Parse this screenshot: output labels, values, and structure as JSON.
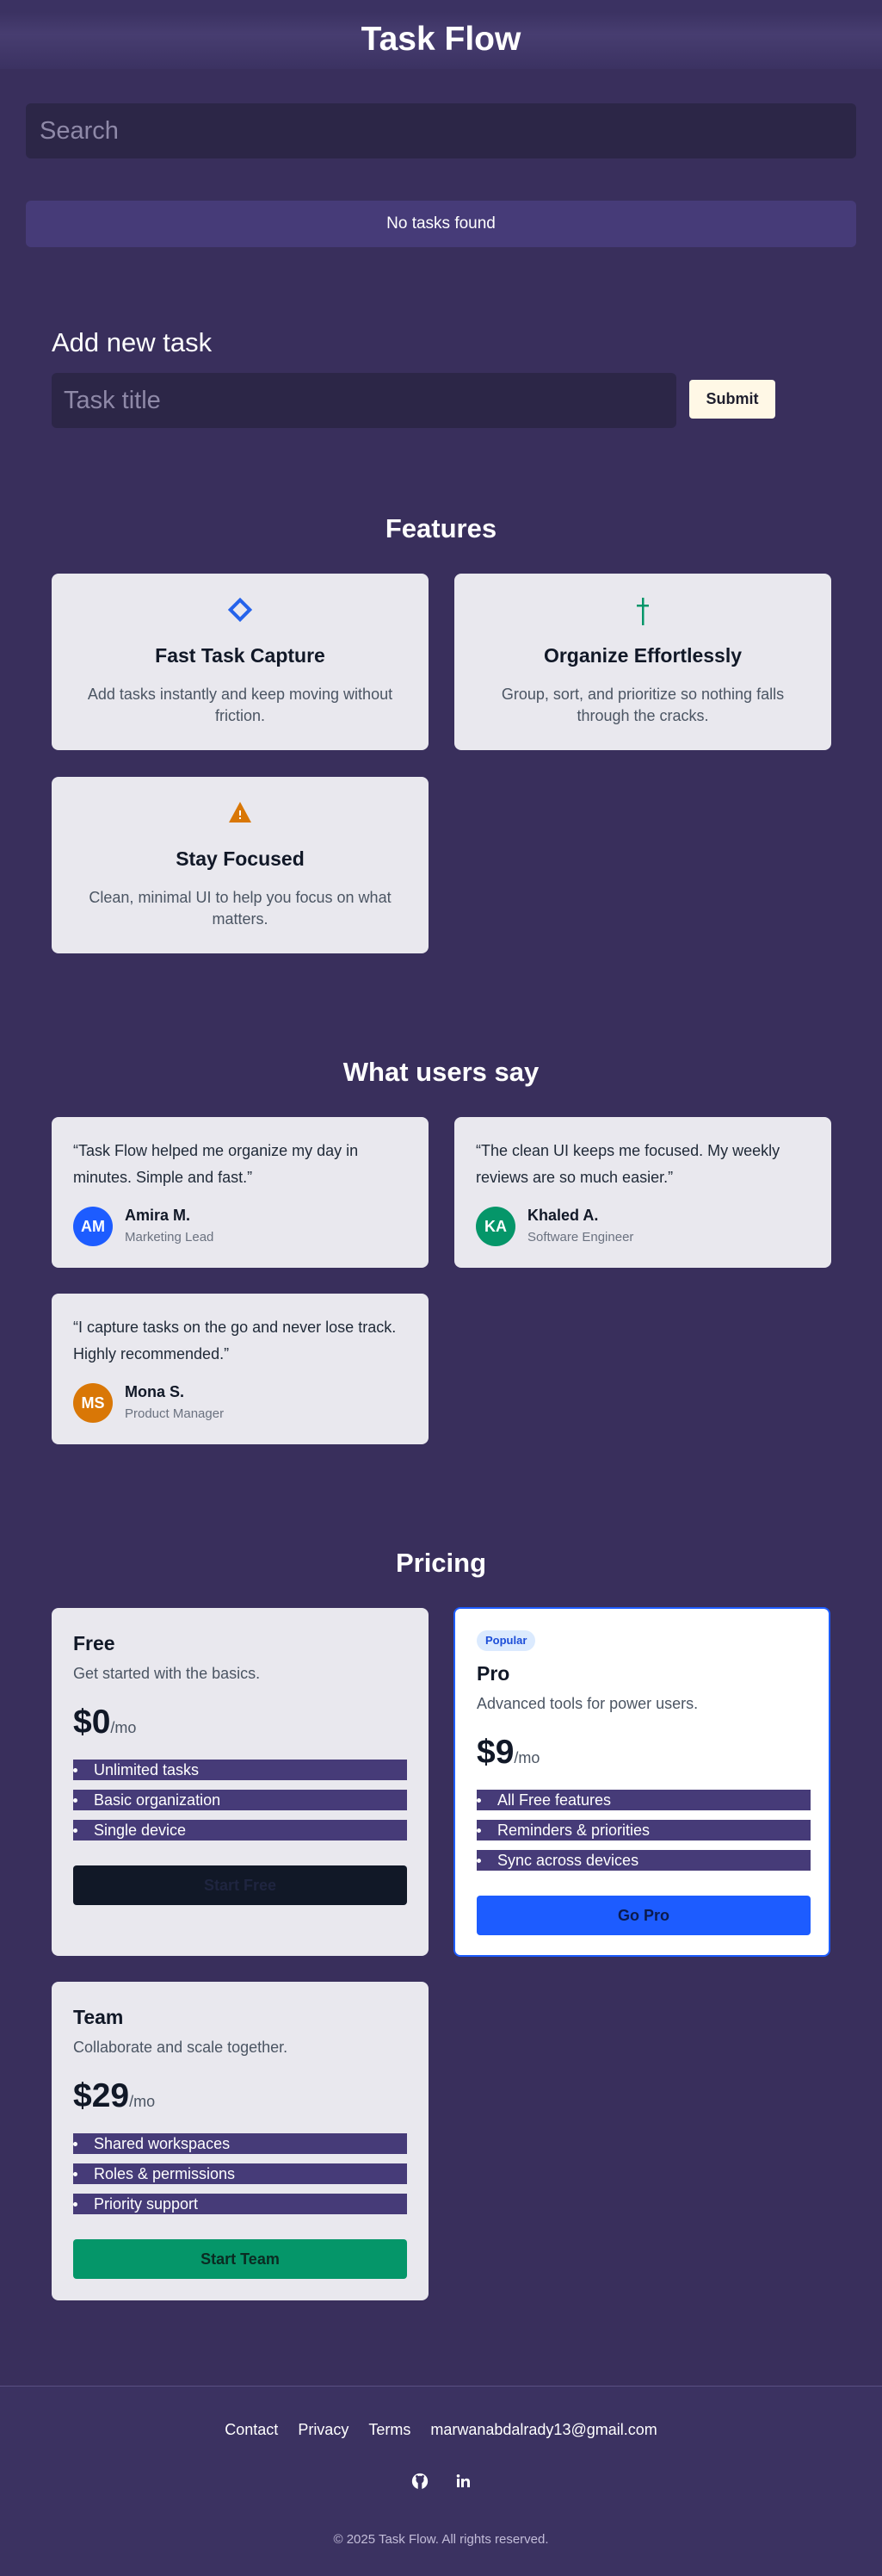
{
  "app": {
    "title": "Task Flow"
  },
  "search": {
    "placeholder": "Search"
  },
  "tasks": {
    "empty_message": "No tasks found"
  },
  "add_task": {
    "heading": "Add new task",
    "placeholder": "Task title",
    "submit_label": "Submit"
  },
  "features": {
    "heading": "Features",
    "items": [
      {
        "icon": "diamond-icon",
        "title": "Fast Task Capture",
        "description": "Add tasks instantly and keep moving without friction.",
        "color": "#2563eb"
      },
      {
        "icon": "dagger-icon",
        "title": "Organize Effortlessly",
        "description": "Group, sort, and prioritize so nothing falls through the cracks.",
        "color": "#059669"
      },
      {
        "icon": "warning-triangle-icon",
        "title": "Stay Focused",
        "description": "Clean, minimal UI to help you focus on what matters.",
        "color": "#d97706"
      }
    ]
  },
  "testimonials": {
    "heading": "What users say",
    "items": [
      {
        "quote": "“Task Flow helped me organize my day in minutes. Simple and fast.”",
        "initials": "AM",
        "name": "Amira M.",
        "role": "Marketing Lead",
        "color": "#2563eb"
      },
      {
        "quote": "“The clean UI keeps me focused. My weekly reviews are so much easier.”",
        "initials": "KA",
        "name": "Khaled A.",
        "role": "Software Engineer",
        "color": "#059669"
      },
      {
        "quote": "“I capture tasks on the go and never lose track. Highly recommended.”",
        "initials": "MS",
        "name": "Mona S.",
        "role": "Product Manager",
        "color": "#d97706"
      }
    ]
  },
  "pricing": {
    "heading": "Pricing",
    "plans": [
      {
        "name": "Free",
        "description": "Get started with the basics.",
        "price": "$0",
        "period": "/mo",
        "features": [
          "Unlimited tasks",
          "Basic organization",
          "Single device"
        ],
        "cta": "Start Free",
        "button_color": "#111827",
        "button_text_color": "#1f2540"
      },
      {
        "badge": "Popular",
        "name": "Pro",
        "description": "Advanced tools for power users.",
        "price": "$9",
        "period": "/mo",
        "features": [
          "All Free features",
          "Reminders & priorities",
          "Sync across devices"
        ],
        "cta": "Go Pro",
        "button_color": "#1d5cff",
        "button_text_color": "#0b1a4d"
      },
      {
        "name": "Team",
        "description": "Collaborate and scale together.",
        "price": "$29",
        "period": "/mo",
        "features": [
          "Shared workspaces",
          "Roles & permissions",
          "Priority support"
        ],
        "cta": "Start Team",
        "button_color": "#059669",
        "button_text_color": "#0b2b22"
      }
    ]
  },
  "footer": {
    "links": [
      "Contact",
      "Privacy",
      "Terms",
      "marwanabdalrady13@gmail.com"
    ],
    "socials": [
      "github-icon",
      "linkedin-icon"
    ],
    "copyright": "© 2025 Task Flow. All rights reserved."
  },
  "colors": {
    "background": "#392f5c",
    "accent": "#1d5cff",
    "card": "#e9e8ee"
  }
}
